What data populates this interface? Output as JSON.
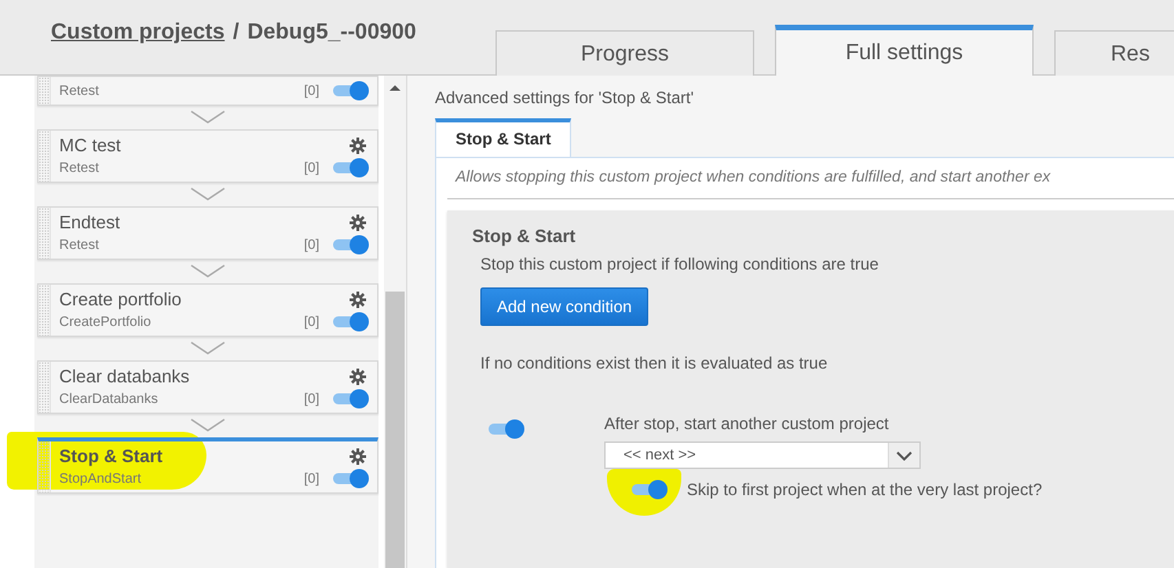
{
  "header": {
    "link": "Custom projects",
    "separator": "/",
    "title": "Debug5_--00900"
  },
  "tabs": [
    {
      "label": "Progress",
      "selected": false
    },
    {
      "label": "Full settings",
      "selected": true
    },
    {
      "label": "Res",
      "selected": false
    }
  ],
  "sidebar": {
    "items": [
      {
        "subtitle": "Retest",
        "count": "[0]",
        "enabled": true,
        "selected": false,
        "highlighted": false
      },
      {
        "name": "MC test",
        "subtitle": "Retest",
        "count": "[0]",
        "enabled": true,
        "selected": false,
        "highlighted": false
      },
      {
        "name": "Endtest",
        "subtitle": "Retest",
        "count": "[0]",
        "enabled": true,
        "selected": false,
        "highlighted": false
      },
      {
        "name": "Create portfolio",
        "subtitle": "CreatePortfolio",
        "count": "[0]",
        "enabled": true,
        "selected": false,
        "highlighted": false
      },
      {
        "name": "Clear databanks",
        "subtitle": "ClearDatabanks",
        "count": "[0]",
        "enabled": true,
        "selected": false,
        "highlighted": false
      },
      {
        "name": "Stop & Start",
        "subtitle": "StopAndStart",
        "count": "[0]",
        "enabled": true,
        "selected": true,
        "highlighted": true
      }
    ]
  },
  "settings": {
    "heading": "Advanced settings for 'Stop & Start'",
    "tabs": [
      {
        "label": "Stop & Start",
        "selected": true
      }
    ],
    "description": "Allows stopping this custom project when conditions are fulfilled, and start another ex",
    "section": {
      "title": "Stop & Start",
      "condition_text": "Stop this custom project if following conditions are true",
      "add_button": "Add new condition",
      "note": "If no conditions exist then it is evaluated as true",
      "start_another": {
        "on": true,
        "label": "After stop, start another custom project",
        "select_value": "<< next >>"
      },
      "skip_first": {
        "on": true,
        "label": "Skip to first project when at the very last project?",
        "highlighted": true
      }
    }
  }
}
